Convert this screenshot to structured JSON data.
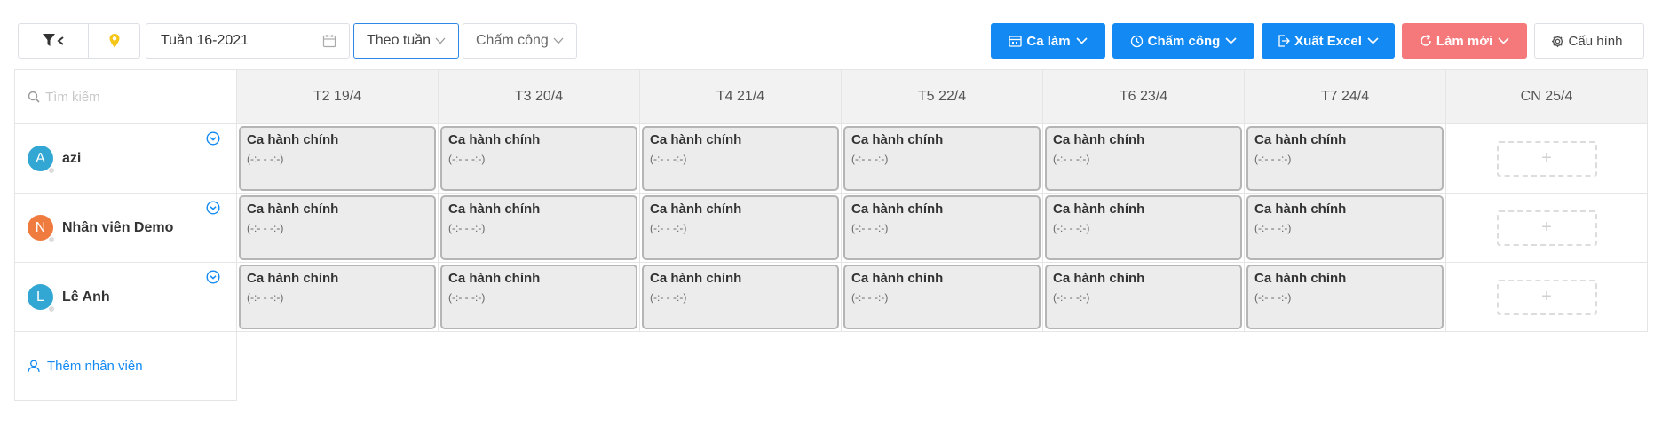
{
  "toolbar": {
    "week_value": "Tuần 16-2021",
    "view_mode": "Theo tuần",
    "data_mode": "Chấm công",
    "ca_lam": "Ca làm",
    "cham_cong": "Chấm công",
    "xuat_excel": "Xuất Excel",
    "lam_moi": "Làm mới",
    "cau_hinh": "Cấu hình"
  },
  "search": {
    "placeholder": "Tìm kiếm"
  },
  "days": [
    "T2 19/4",
    "T3 20/4",
    "T4 21/4",
    "T5 22/4",
    "T6 23/4",
    "T7 24/4",
    "CN 25/4"
  ],
  "employees": [
    {
      "initial": "A",
      "name": "azi",
      "avatar_color": "#32a7d3"
    },
    {
      "initial": "N",
      "name": "Nhân viên Demo",
      "avatar_color": "#f07b3f"
    },
    {
      "initial": "L",
      "name": "Lê Anh",
      "avatar_color": "#32a7d3"
    }
  ],
  "shift": {
    "name": "Ca hành chính",
    "time": "(-:- - -:-)"
  },
  "add_employee": "Thêm nhân viên",
  "colors": {
    "primary": "#1289f3",
    "refresh": "#f5787a",
    "shift_bg": "#ececec",
    "header_bg": "#f2f2f2"
  }
}
